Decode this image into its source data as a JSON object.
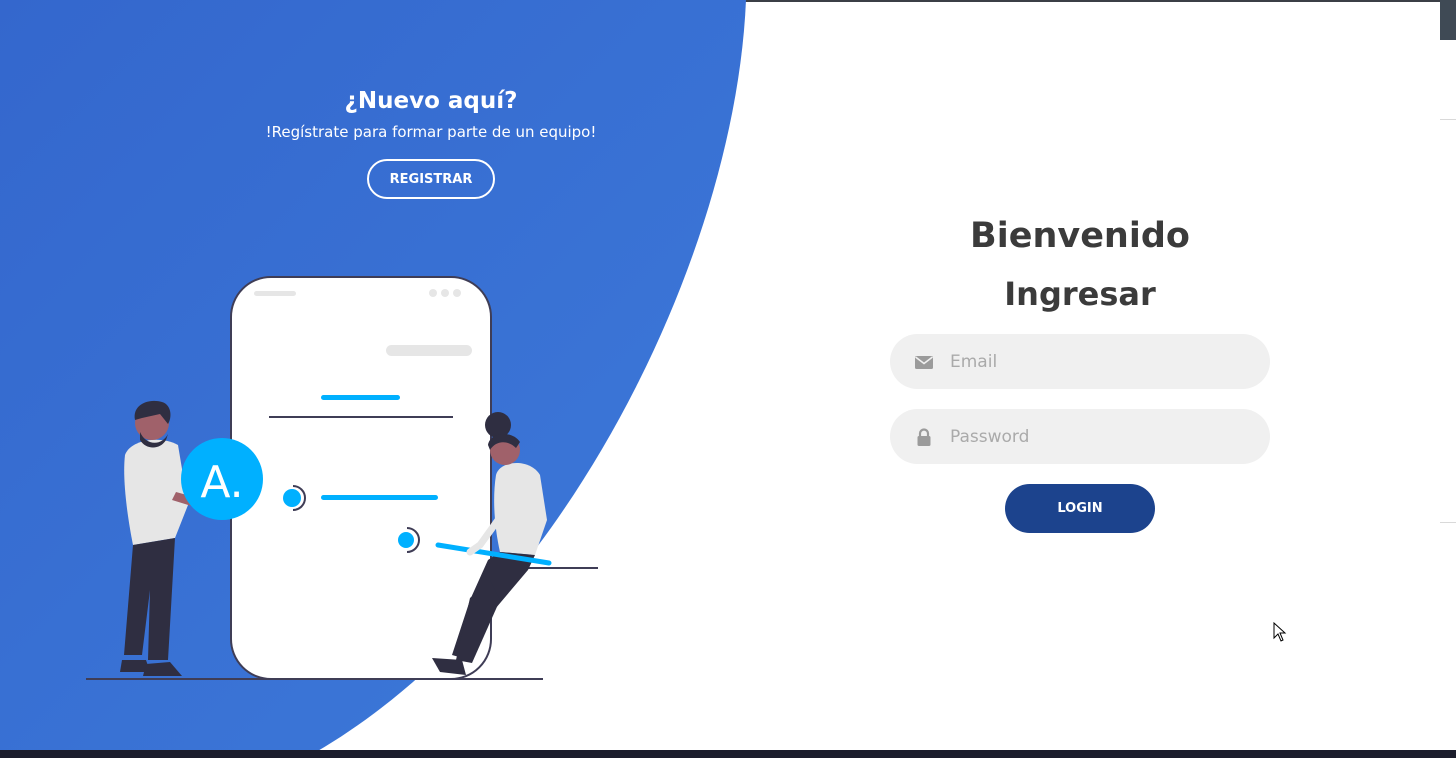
{
  "signup_panel": {
    "title": "¿Nuevo aquí?",
    "subtitle": "!Regístrate para formar parte de un equipo!",
    "register_label": "REGISTRAR"
  },
  "login_panel": {
    "welcome": "Bienvenido",
    "title": "Ingresar",
    "email_placeholder": "Email",
    "password_placeholder": "Password",
    "login_label": "LOGIN"
  },
  "illustration": {
    "badge_letter": "A."
  },
  "icons": {
    "email": "envelope-icon",
    "password": "lock-icon"
  },
  "colors": {
    "panel_blue": "#3b73d6",
    "login_button": "#1c438d",
    "accent_cyan": "#00b0ff",
    "input_bg": "#f0f0f0"
  }
}
